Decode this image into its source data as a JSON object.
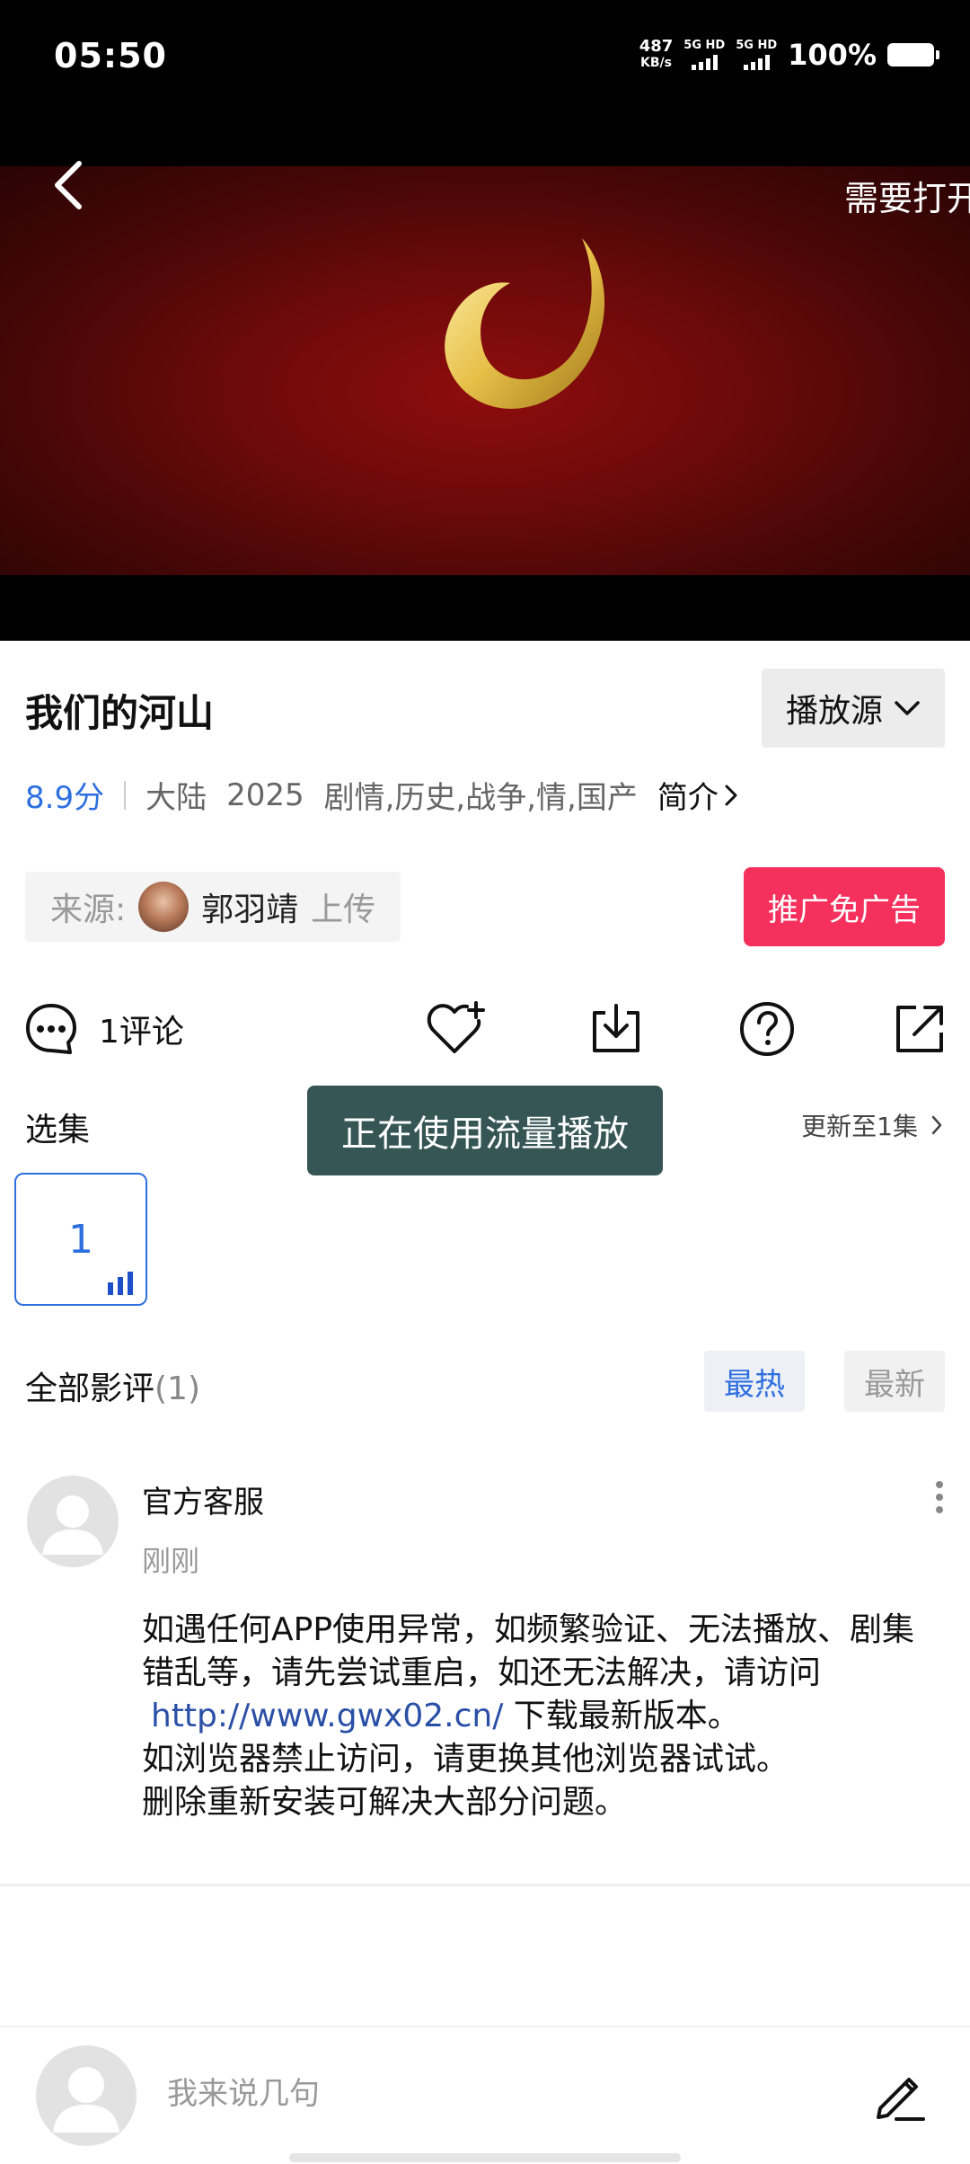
{
  "status_bar": {
    "time": "05:50",
    "net_speed_value": "487",
    "net_speed_unit": "KB/s",
    "sim1_label": "5G HD",
    "sim2_label": "5G HD",
    "battery": "100%"
  },
  "video": {
    "marquee_text": "需要打开"
  },
  "movie": {
    "title": "我们的河山",
    "source_button": "播放源",
    "rating": "8.9分",
    "region": "大陆",
    "year": "2025",
    "genres": "剧情,历史,战争,情,国产",
    "intro_label": "简介"
  },
  "uploader": {
    "label": "来源:",
    "name": "郭羽靖",
    "action": "上传"
  },
  "promo_button": "推广免广告",
  "actions": {
    "comment_count": "1评论"
  },
  "episodes": {
    "title": "选集",
    "update": "更新至1集",
    "items": [
      {
        "label": "1"
      }
    ]
  },
  "toast": "正在使用流量播放",
  "reviews": {
    "title": "全部影评",
    "count": "(1)",
    "sort_hot": "最热",
    "sort_new": "最新",
    "items": [
      {
        "author": "官方客服",
        "time": "刚刚",
        "line1": "如遇任何APP使用异常，如频繁验证、无法播放、剧集错乱等，请先尝试重启，如还无法解决，请访问",
        "link": "http://www.gwx02.cn/",
        "line2": " 下载最新版本。",
        "line3": "如浏览器禁止访问，请更换其他浏览器试试。",
        "line4": "删除重新安装可解决大部分问题。"
      }
    ]
  },
  "bottom": {
    "input_placeholder": "我来说几句"
  },
  "colors": {
    "accent_blue": "#2e6fe0",
    "promo_red": "#f5305d",
    "toast_bg": "#365555"
  }
}
